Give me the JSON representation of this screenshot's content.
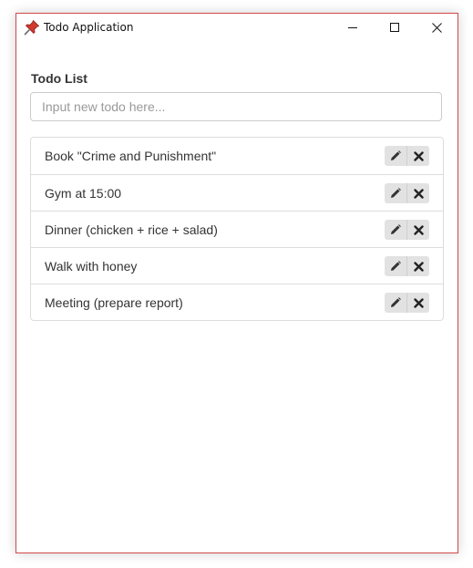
{
  "window": {
    "title": "Todo Application",
    "icon": "pushpin-icon",
    "accent_border": "#d04a4a"
  },
  "main": {
    "heading": "Todo List",
    "input": {
      "placeholder": "Input new todo here...",
      "value": ""
    },
    "todos": [
      {
        "label": "Book \"Crime and Punishment\""
      },
      {
        "label": "Gym at 15:00"
      },
      {
        "label": "Dinner (chicken + rice + salad)"
      },
      {
        "label": "Walk with honey"
      },
      {
        "label": "Meeting (prepare report)"
      }
    ],
    "item_actions": [
      "pencil-icon",
      "cross-icon"
    ]
  }
}
